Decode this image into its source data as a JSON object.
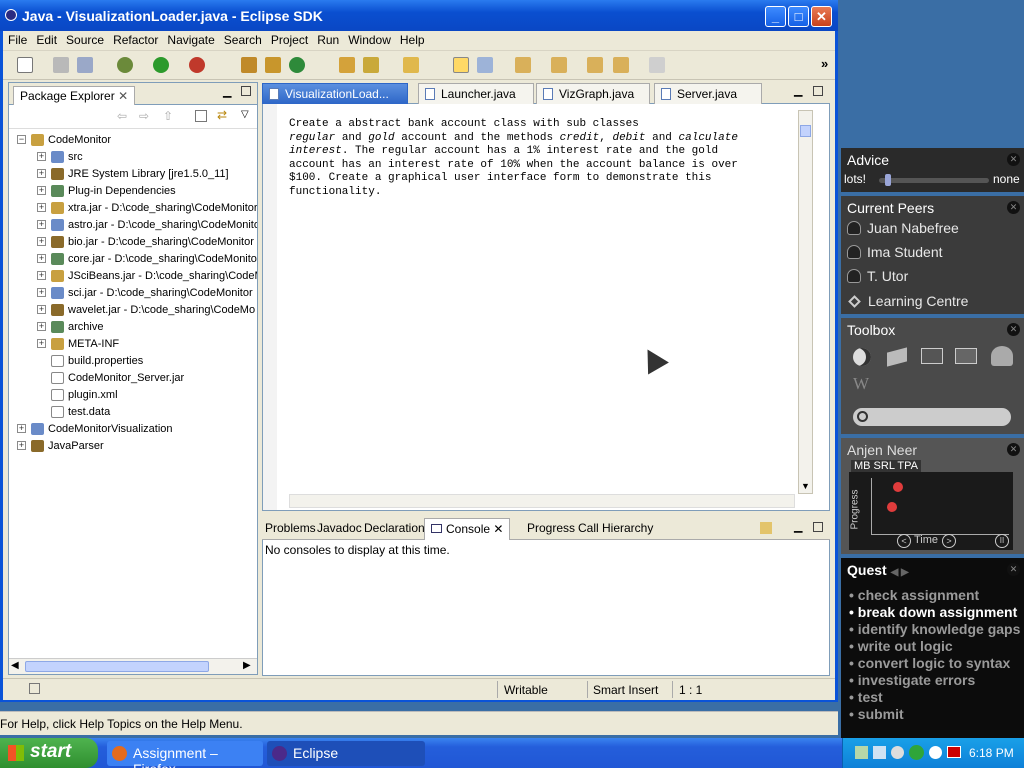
{
  "window": {
    "title": "Java - VisualizationLoader.java - Eclipse SDK"
  },
  "menu": [
    "File",
    "Edit",
    "Source",
    "Refactor",
    "Navigate",
    "Search",
    "Project",
    "Run",
    "Window",
    "Help"
  ],
  "package_explorer": {
    "title": "Package Explorer",
    "items": [
      {
        "label": "CodeMonitor",
        "depth": 0,
        "expanded": true
      },
      {
        "label": "src",
        "depth": 1
      },
      {
        "label": "JRE System Library [jre1.5.0_11]",
        "depth": 1
      },
      {
        "label": "Plug-in Dependencies",
        "depth": 1
      },
      {
        "label": "xtra.jar - D:\\code_sharing\\CodeMonitor",
        "depth": 1
      },
      {
        "label": "astro.jar - D:\\code_sharing\\CodeMonitor",
        "depth": 1
      },
      {
        "label": "bio.jar - D:\\code_sharing\\CodeMonitor",
        "depth": 1
      },
      {
        "label": "core.jar - D:\\code_sharing\\CodeMonitor",
        "depth": 1
      },
      {
        "label": "JSciBeans.jar - D:\\code_sharing\\CodeM",
        "depth": 1
      },
      {
        "label": "sci.jar - D:\\code_sharing\\CodeMonitor",
        "depth": 1
      },
      {
        "label": "wavelet.jar - D:\\code_sharing\\CodeMo",
        "depth": 1
      },
      {
        "label": "archive",
        "depth": 1
      },
      {
        "label": "META-INF",
        "depth": 1
      },
      {
        "label": "build.properties",
        "depth": 1,
        "leaf": true
      },
      {
        "label": "CodeMonitor_Server.jar",
        "depth": 1,
        "leaf": true
      },
      {
        "label": "plugin.xml",
        "depth": 1,
        "leaf": true
      },
      {
        "label": "test.data",
        "depth": 1,
        "leaf": true
      },
      {
        "label": "CodeMonitorVisualization",
        "depth": 0
      },
      {
        "label": "JavaParser",
        "depth": 0
      }
    ]
  },
  "editor": {
    "tabs": [
      "VisualizationLoad...",
      "Launcher.java",
      "VizGraph.java",
      "Server.java"
    ],
    "text": {
      "l1": "Create a abstract bank account class with sub classes",
      "l2a": "regular",
      "l2b": " and ",
      "l2c": "gold",
      "l2d": " account and the methods ",
      "l2e": "credit",
      "l2f": ", ",
      "l2g": "debit",
      "l2h": " and ",
      "l2i": "calculate",
      "l3a": "interest",
      "l3b": ". The regular account has a 1% interest rate and the gold",
      "l4": "account has an interest rate of 10% when the account balance is over",
      "l5": "$100. Create a graphical user interface form to demonstrate this",
      "l6": "functionality."
    }
  },
  "console": {
    "tabs": [
      "Problems",
      "Javadoc",
      "Declaration",
      "Console",
      "Progress",
      "Call Hierarchy"
    ],
    "message": "No consoles to display at this time."
  },
  "status": {
    "writable": "Writable",
    "insert": "Smart Insert",
    "position": "1 : 1"
  },
  "help_text": "For Help, click Help Topics on the Help Menu.",
  "advice": {
    "title": "Advice",
    "left": "lots!",
    "right": "none",
    "level": 0.05
  },
  "peers": {
    "title": "Current Peers",
    "items": [
      "Juan Nabefree",
      "Ima Student",
      "T. Utor",
      "Learning Centre"
    ]
  },
  "toolbox": {
    "title": "Toolbox"
  },
  "progress": {
    "name": "Anjen Neer",
    "tabs": "MB SRL TPA",
    "ylabel": "Progress",
    "xlabel": "Time"
  },
  "quest": {
    "title": "Quest",
    "items": [
      "check assignment",
      "break down assignment",
      "identify knowledge gaps",
      "write out logic",
      "convert logic to syntax",
      "investigate errors",
      "test",
      "submit"
    ],
    "current": 1
  },
  "taskbar": {
    "start": "start",
    "tasks": [
      "Assignment – Firefox",
      "Eclipse"
    ],
    "clock": "6:18 PM"
  }
}
